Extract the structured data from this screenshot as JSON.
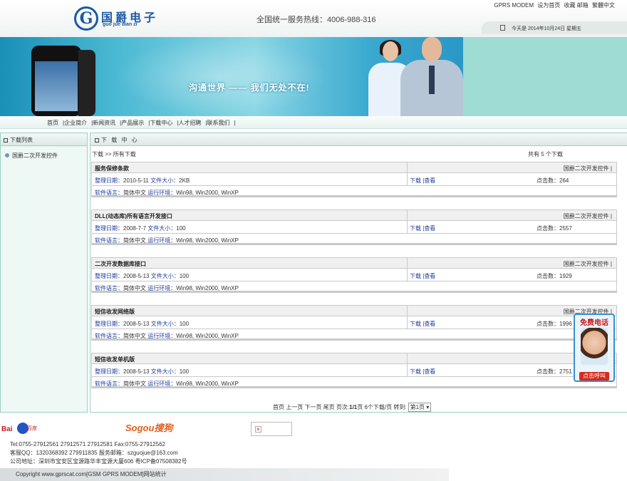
{
  "header": {
    "logo_letter": "G",
    "logo_cn": "国爵电子",
    "logo_pinyin": "guo jue dian zi",
    "hotline": "全国统一服务热线：4006-988-316",
    "top_links": [
      "GPRS MODEM",
      "设为首页",
      "收藏",
      "邮箱",
      "繁體中文"
    ],
    "date": "今天是 2014年10月24日  星期五"
  },
  "banner": {
    "slogan": "沟通世界 —— 我们无处不在!"
  },
  "nav": {
    "items": [
      "首页",
      "企业简介",
      "新闻资讯",
      "产品展示",
      "下载中心",
      "人才招聘",
      "联系我们"
    ],
    "separator": "|"
  },
  "sidebar": {
    "title": "下载列表",
    "items": [
      "国爵二次开发控件"
    ]
  },
  "main": {
    "title": "下 载 中 心",
    "breadcrumb": "下载 >> 所有下载",
    "total": "共有  5 个下载",
    "labels": {
      "date": "整理日期：",
      "size": "文件大小：",
      "lang": "软件语言：",
      "env": "运行环境：",
      "download": "下载",
      "view": "查看",
      "pipe": "|",
      "hits": "点击数："
    },
    "records": [
      {
        "name": "服务保修条款",
        "category": "国爵二次开发控件 |",
        "date": "2010-5-11",
        "size": "2KB",
        "hits": "264",
        "lang": "简体中文",
        "env": "Win98, Win2000, WinXP"
      },
      {
        "name": "DLL(动态库)所有语言开发接口",
        "category": "国爵二次开发控件 |",
        "date": "2008-7-7",
        "size": "100",
        "hits": "2557",
        "lang": "简体中文",
        "env": "Win98, Win2000, WinXP"
      },
      {
        "name": "二次开发数据库接口",
        "category": "国爵二次开发控件 |",
        "date": "2008-5-13",
        "size": "100",
        "hits": "1929",
        "lang": "简体中文",
        "env": "Win98, Win2000, WinXP"
      },
      {
        "name": "短信收发网络版",
        "category": "国爵二次开发控件 |",
        "date": "2008-5-13",
        "size": "100",
        "hits": "1996",
        "lang": "简体中文",
        "env": "Win98, Win2000, WinXP"
      },
      {
        "name": "短信收发单机版",
        "category": "国爵",
        "date": "2008-5-13",
        "size": "100",
        "hits": "2751",
        "lang": "简体中文",
        "env": "Win98, Win2000, WinXP"
      }
    ],
    "pager": {
      "text": "首页  上一页 下一页  尾页 页次:",
      "page": "1/1",
      "suffix": "页  6个下载/页  转到:",
      "select": "第1页 ▾"
    }
  },
  "float": {
    "title": "免费电话",
    "button": "点击呼叫"
  },
  "footer": {
    "baidu_du": "Bai",
    "baidu_cn": "百度",
    "sogou": "Sogou搜狗",
    "broken_img": "×",
    "tel": "Tel:0755-27912561 27912571 27912581 Fax:0755-27912562",
    "qq": "客服QQ：1320368392 279911835 服务邮箱：szguojue@163.com",
    "address": "公司地址：深圳市宝安区宝源路华丰宝源大厦606 粤ICP备07508382号",
    "copyright": "Copyright www.gprscat.com[GSM GPRS MODEM]网站统计"
  },
  "colors": {
    "brand_blue": "#1c58a6",
    "border_teal": "#9bd1c3",
    "link_blue": "#1c3c9c",
    "call_red": "#d62a1c"
  }
}
